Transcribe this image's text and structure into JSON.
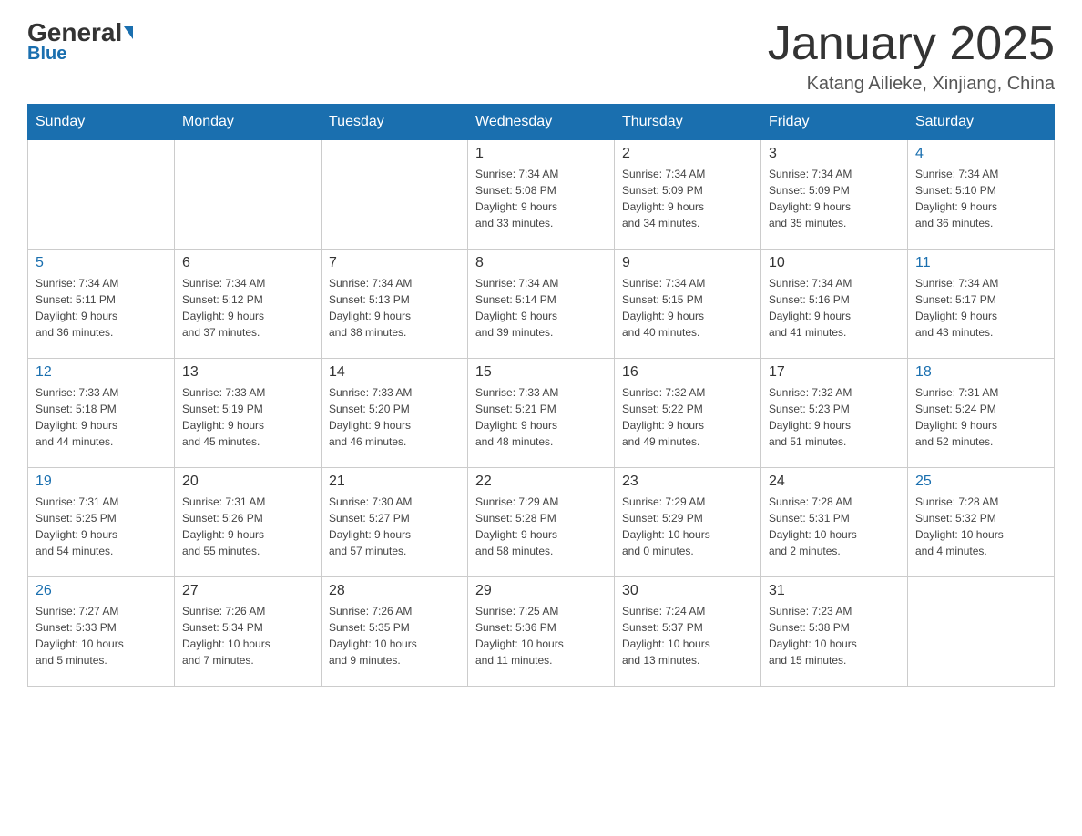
{
  "logo": {
    "general": "General",
    "blue": "Blue"
  },
  "title": "January 2025",
  "subtitle": "Katang Ailieke, Xinjiang, China",
  "days_of_week": [
    "Sunday",
    "Monday",
    "Tuesday",
    "Wednesday",
    "Thursday",
    "Friday",
    "Saturday"
  ],
  "weeks": [
    [
      {
        "day": "",
        "info": ""
      },
      {
        "day": "",
        "info": ""
      },
      {
        "day": "",
        "info": ""
      },
      {
        "day": "1",
        "info": "Sunrise: 7:34 AM\nSunset: 5:08 PM\nDaylight: 9 hours\nand 33 minutes."
      },
      {
        "day": "2",
        "info": "Sunrise: 7:34 AM\nSunset: 5:09 PM\nDaylight: 9 hours\nand 34 minutes."
      },
      {
        "day": "3",
        "info": "Sunrise: 7:34 AM\nSunset: 5:09 PM\nDaylight: 9 hours\nand 35 minutes."
      },
      {
        "day": "4",
        "info": "Sunrise: 7:34 AM\nSunset: 5:10 PM\nDaylight: 9 hours\nand 36 minutes."
      }
    ],
    [
      {
        "day": "5",
        "info": "Sunrise: 7:34 AM\nSunset: 5:11 PM\nDaylight: 9 hours\nand 36 minutes."
      },
      {
        "day": "6",
        "info": "Sunrise: 7:34 AM\nSunset: 5:12 PM\nDaylight: 9 hours\nand 37 minutes."
      },
      {
        "day": "7",
        "info": "Sunrise: 7:34 AM\nSunset: 5:13 PM\nDaylight: 9 hours\nand 38 minutes."
      },
      {
        "day": "8",
        "info": "Sunrise: 7:34 AM\nSunset: 5:14 PM\nDaylight: 9 hours\nand 39 minutes."
      },
      {
        "day": "9",
        "info": "Sunrise: 7:34 AM\nSunset: 5:15 PM\nDaylight: 9 hours\nand 40 minutes."
      },
      {
        "day": "10",
        "info": "Sunrise: 7:34 AM\nSunset: 5:16 PM\nDaylight: 9 hours\nand 41 minutes."
      },
      {
        "day": "11",
        "info": "Sunrise: 7:34 AM\nSunset: 5:17 PM\nDaylight: 9 hours\nand 43 minutes."
      }
    ],
    [
      {
        "day": "12",
        "info": "Sunrise: 7:33 AM\nSunset: 5:18 PM\nDaylight: 9 hours\nand 44 minutes."
      },
      {
        "day": "13",
        "info": "Sunrise: 7:33 AM\nSunset: 5:19 PM\nDaylight: 9 hours\nand 45 minutes."
      },
      {
        "day": "14",
        "info": "Sunrise: 7:33 AM\nSunset: 5:20 PM\nDaylight: 9 hours\nand 46 minutes."
      },
      {
        "day": "15",
        "info": "Sunrise: 7:33 AM\nSunset: 5:21 PM\nDaylight: 9 hours\nand 48 minutes."
      },
      {
        "day": "16",
        "info": "Sunrise: 7:32 AM\nSunset: 5:22 PM\nDaylight: 9 hours\nand 49 minutes."
      },
      {
        "day": "17",
        "info": "Sunrise: 7:32 AM\nSunset: 5:23 PM\nDaylight: 9 hours\nand 51 minutes."
      },
      {
        "day": "18",
        "info": "Sunrise: 7:31 AM\nSunset: 5:24 PM\nDaylight: 9 hours\nand 52 minutes."
      }
    ],
    [
      {
        "day": "19",
        "info": "Sunrise: 7:31 AM\nSunset: 5:25 PM\nDaylight: 9 hours\nand 54 minutes."
      },
      {
        "day": "20",
        "info": "Sunrise: 7:31 AM\nSunset: 5:26 PM\nDaylight: 9 hours\nand 55 minutes."
      },
      {
        "day": "21",
        "info": "Sunrise: 7:30 AM\nSunset: 5:27 PM\nDaylight: 9 hours\nand 57 minutes."
      },
      {
        "day": "22",
        "info": "Sunrise: 7:29 AM\nSunset: 5:28 PM\nDaylight: 9 hours\nand 58 minutes."
      },
      {
        "day": "23",
        "info": "Sunrise: 7:29 AM\nSunset: 5:29 PM\nDaylight: 10 hours\nand 0 minutes."
      },
      {
        "day": "24",
        "info": "Sunrise: 7:28 AM\nSunset: 5:31 PM\nDaylight: 10 hours\nand 2 minutes."
      },
      {
        "day": "25",
        "info": "Sunrise: 7:28 AM\nSunset: 5:32 PM\nDaylight: 10 hours\nand 4 minutes."
      }
    ],
    [
      {
        "day": "26",
        "info": "Sunrise: 7:27 AM\nSunset: 5:33 PM\nDaylight: 10 hours\nand 5 minutes."
      },
      {
        "day": "27",
        "info": "Sunrise: 7:26 AM\nSunset: 5:34 PM\nDaylight: 10 hours\nand 7 minutes."
      },
      {
        "day": "28",
        "info": "Sunrise: 7:26 AM\nSunset: 5:35 PM\nDaylight: 10 hours\nand 9 minutes."
      },
      {
        "day": "29",
        "info": "Sunrise: 7:25 AM\nSunset: 5:36 PM\nDaylight: 10 hours\nand 11 minutes."
      },
      {
        "day": "30",
        "info": "Sunrise: 7:24 AM\nSunset: 5:37 PM\nDaylight: 10 hours\nand 13 minutes."
      },
      {
        "day": "31",
        "info": "Sunrise: 7:23 AM\nSunset: 5:38 PM\nDaylight: 10 hours\nand 15 minutes."
      },
      {
        "day": "",
        "info": ""
      }
    ]
  ]
}
